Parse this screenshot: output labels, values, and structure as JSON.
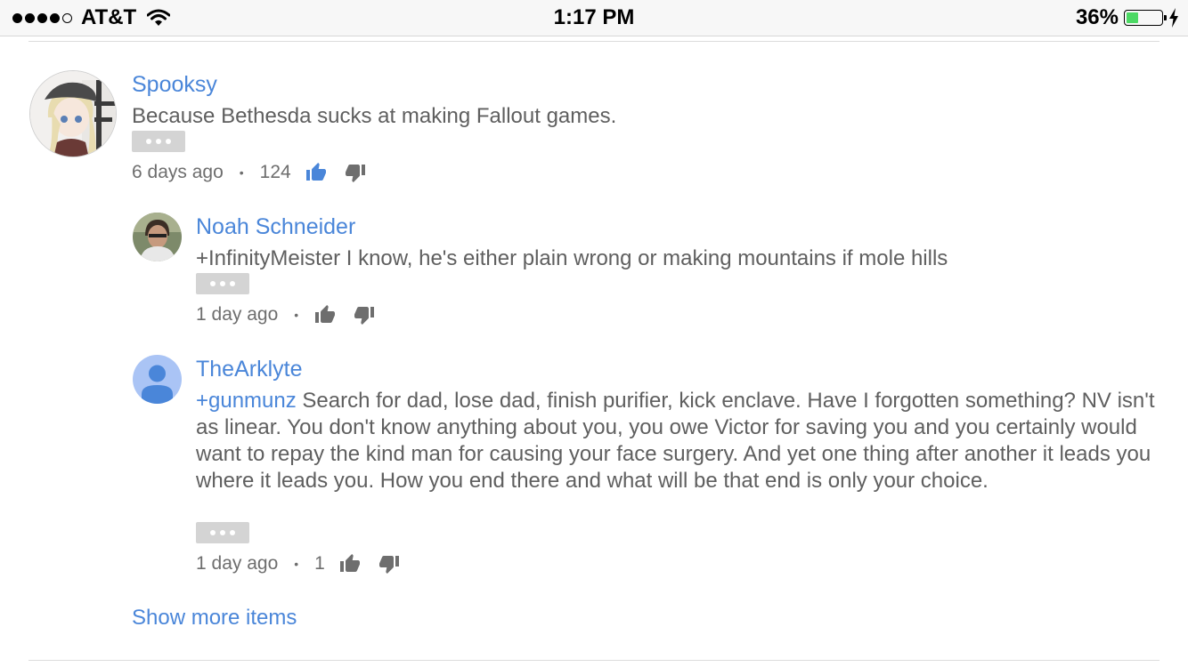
{
  "status_bar": {
    "carrier": "AT&T",
    "time": "1:17 PM",
    "battery_percent": "36%",
    "battery_level": 0.36,
    "signal_bars_filled": 4,
    "signal_bars_total": 5
  },
  "comments": [
    {
      "author": "Spooksy",
      "text": "Because Bethesda sucks at making Fallout games.",
      "time_ago": "6 days ago",
      "likes": "124",
      "liked": true
    }
  ],
  "replies": [
    {
      "author": "Noah Schneider",
      "text": "+InfinityMeister I know, he's either plain wrong or making mountains if mole hills",
      "time_ago": "1 day ago",
      "likes": ""
    },
    {
      "author": "TheArklyte",
      "mention": "+gunmunz",
      "text": " Search for dad, lose dad, finish purifier, kick enclave. Have I forgotten something? NV isn't as linear. You don't know anything about you, you owe Victor for saving you and you certainly would want to repay the kind man for causing your face surgery. And yet one thing after another it leads you where it leads you. How you end there and what will be that end is only your choice.",
      "time_ago": "1 day ago",
      "likes": "1"
    }
  ],
  "show_more_label": "Show more items",
  "icons": {
    "more": "more-horizontal-icon",
    "like": "thumbs-up-icon",
    "dislike": "thumbs-down-icon",
    "wifi": "wifi-icon",
    "charging": "charging-bolt-icon"
  },
  "colors": {
    "link_blue": "#4a86d9",
    "text_gray": "#5f5f5f",
    "battery_green": "#4cd964",
    "more_button_gray": "#d4d4d4"
  }
}
